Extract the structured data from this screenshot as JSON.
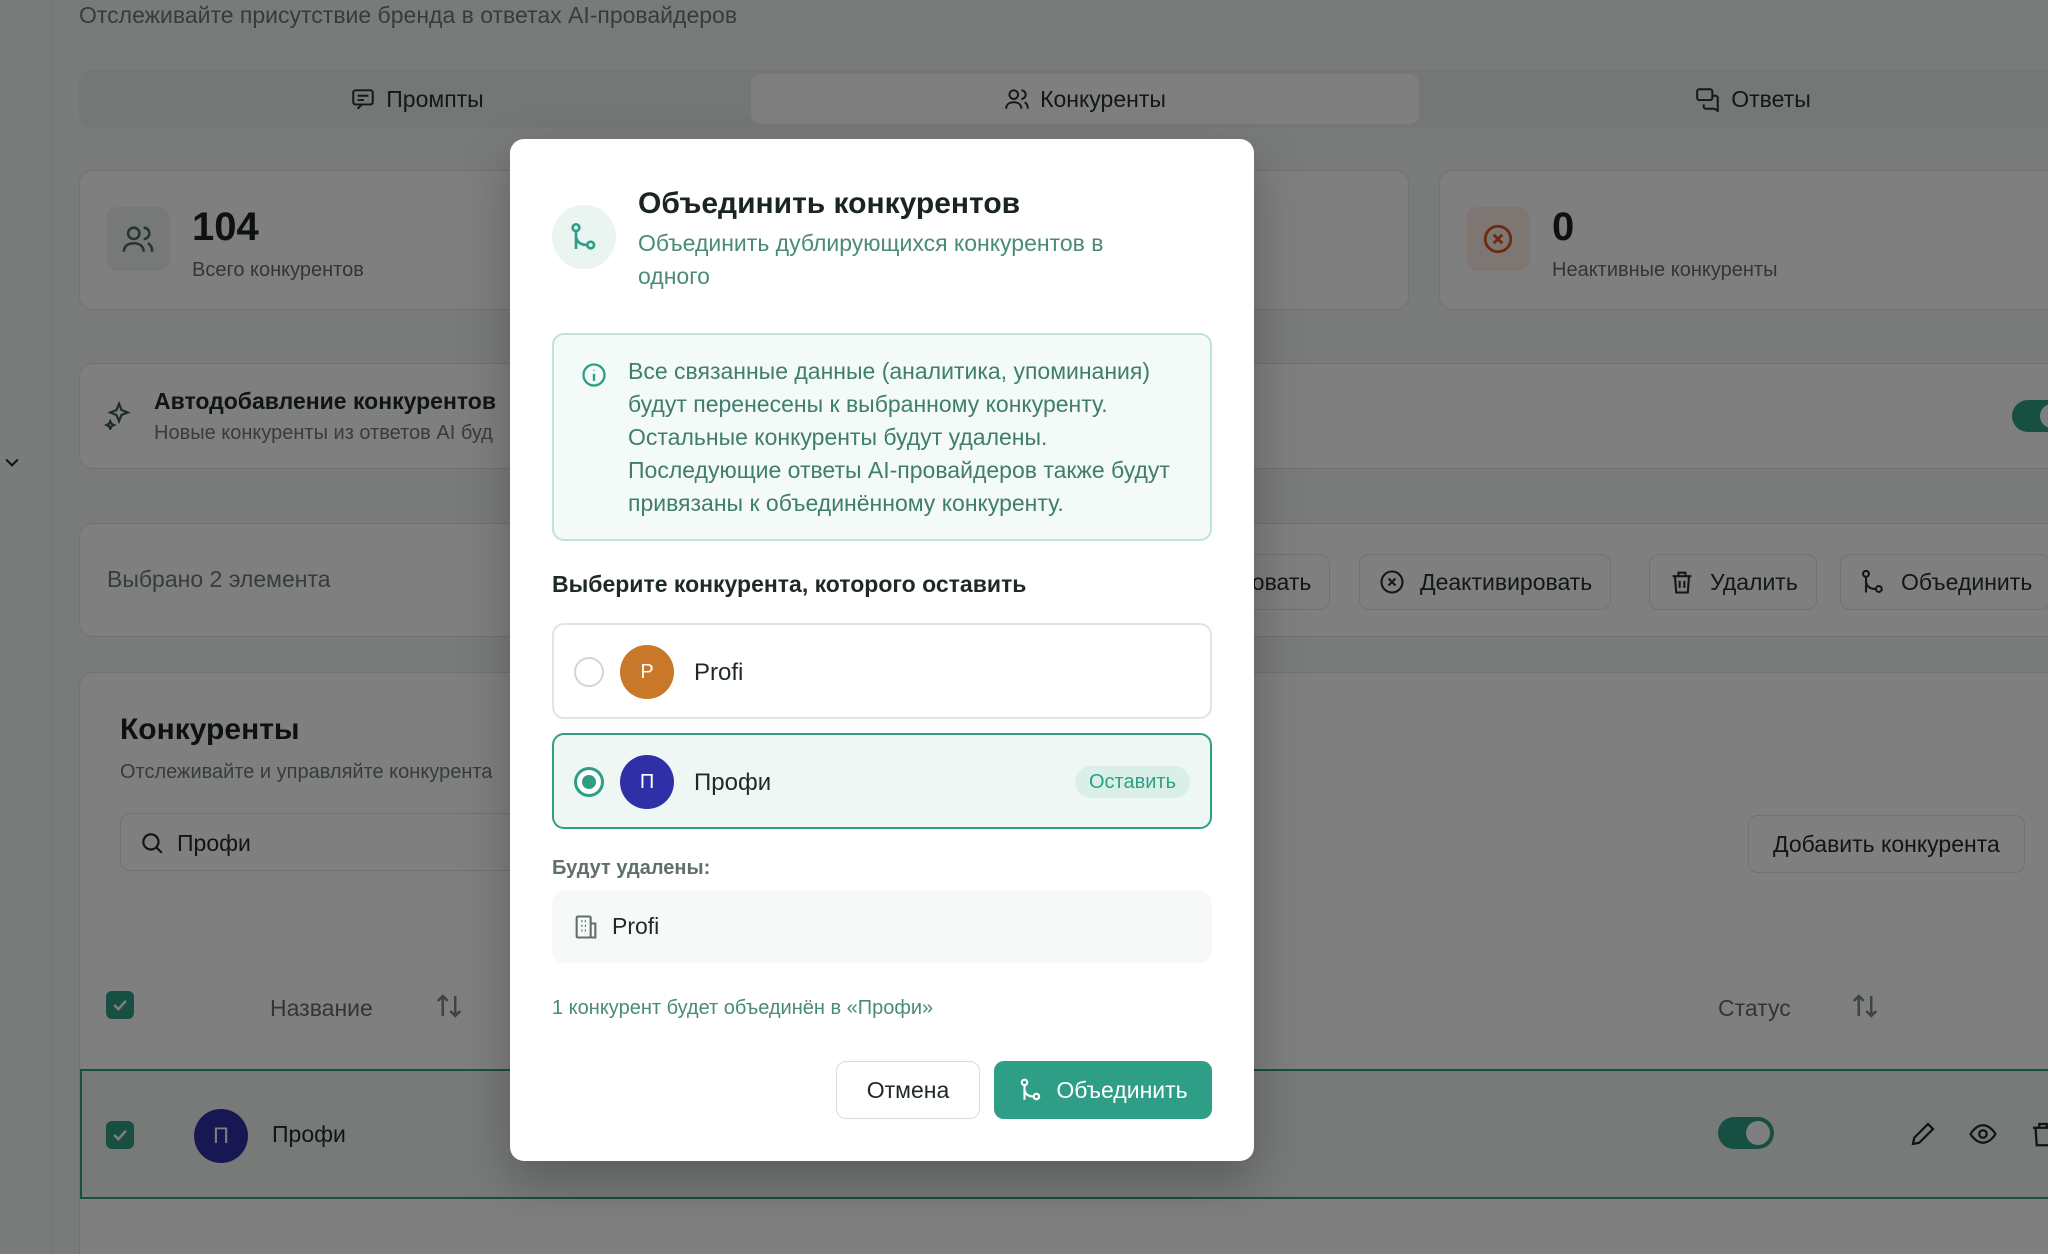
{
  "header": {
    "subtitle": "Отслеживайте присутствие бренда в ответах AI-провайдеров"
  },
  "tabs": [
    {
      "label": "Промпты",
      "icon": "message-square-icon"
    },
    {
      "label": "Конкуренты",
      "icon": "users-icon",
      "active": true
    },
    {
      "label": "Ответы",
      "icon": "messages-icon"
    }
  ],
  "stats": [
    {
      "value": "104",
      "label": "Всего конкурентов",
      "icon": "users-icon"
    },
    {
      "value": "0",
      "label": "Неактивные конкуренты",
      "icon": "x-circle-icon",
      "color": "#d9541e"
    }
  ],
  "auto_add": {
    "title": "Автодобавление конкурентов",
    "description": "Новые конкуренты из ответов AI буд",
    "enabled": true
  },
  "selection_bar": {
    "text": "Выбрано 2 элемента",
    "actions": [
      "ровать",
      "Деактивировать",
      "Удалить",
      "Объединить"
    ]
  },
  "list": {
    "title": "Конкуренты",
    "subtitle": "Отслеживайте и управляйте конкурента",
    "search": {
      "value": "Профи"
    },
    "add_button": "Добавить конкурента",
    "columns": [
      "Название",
      "Статус"
    ],
    "rows": [
      {
        "avatar": "П",
        "name": "Профи",
        "active": true,
        "checked": true
      }
    ]
  },
  "modal": {
    "title": "Объединить конкурентов",
    "description": "Объединить дублирующихся конкурентов в одного",
    "info": "Все связанные данные (аналитика, упоминания) будут перенесены к выбранному конкуренту. Остальные конкуренты будут удалены. Последующие ответы AI-провайдеров также будут привязаны к объединённому конкуренту.",
    "choose_label": "Выберите конкурента, которого оставить",
    "options": [
      {
        "avatar": "P",
        "name": "Profi",
        "color": "#c9782a",
        "selected": false
      },
      {
        "avatar": "П",
        "name": "Профи",
        "color": "#2f2fa8",
        "selected": true,
        "badge": "Оставить"
      }
    ],
    "delete_label": "Будут удалены:",
    "delete_items": [
      {
        "name": "Profi",
        "icon": "building-icon"
      }
    ],
    "merge_note": "1 конкурент будет объединён в «Профи»",
    "cancel_label": "Отмена",
    "merge_label": "Объединить"
  },
  "colors": {
    "accent": "#2f9e86",
    "overlay": "rgba(0,0,0,0.5)"
  }
}
